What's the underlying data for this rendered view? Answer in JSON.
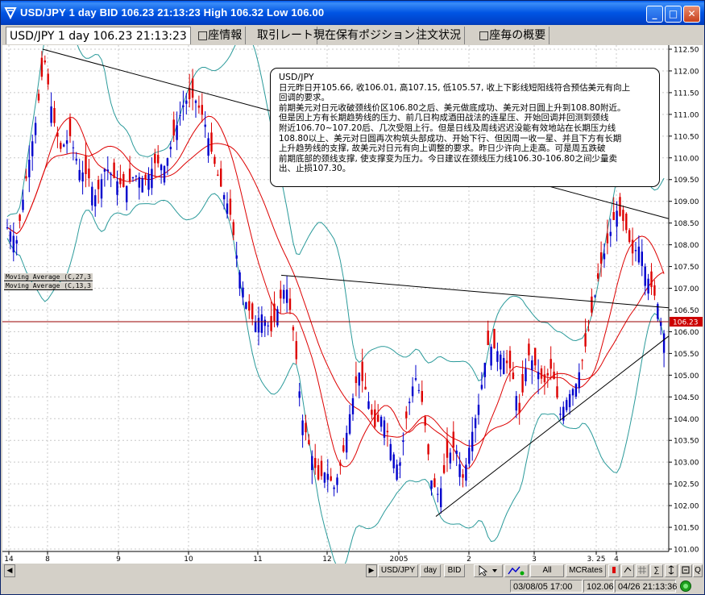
{
  "window": {
    "title": "USD/JPY 1 day BID 106.23 21:13:23 High 106.32 Low 106.00",
    "minimize_label": "_",
    "maximize_label": "□",
    "close_label": "✕"
  },
  "tabs": [
    {
      "label": "USD/JPY 1 day 106.23 21:13:23",
      "active": true
    },
    {
      "label": "□座情報",
      "active": false
    },
    {
      "label": "取引レート",
      "active": false
    },
    {
      "label": "現在保有ポジション",
      "active": false
    },
    {
      "label": "注文状況",
      "active": false
    },
    {
      "label": "□座毎の概要",
      "active": false
    }
  ],
  "annotation": {
    "title": "USD/JPY",
    "lines": [
      "日元昨日开105.66, 收106.01, 高107.15, 低105.57, 收上下影线短阳线符合预估美元有向上",
      "回调的要求。",
      "前期美元对日元收破颈线价区106.80之后、美元做底成功、美元对日圆上升到108.80附近。",
      "但是因上方有长期趋势线的压力、前几日构成酒田战法的连星压、开始回调并回测到颈线",
      "附近106.70~107.20后、几次受阻上行。但是日线及周线迟迟没能有效地站在长期压力线",
      "108.80以上、美元对日圆再次构筑头部成功、开始下行、但因周一收一星、并且下方有长期",
      "上升趋势线的支撑, 故美元对日元有向上调整的要求。昨日少许向上走高。可是周五跌破",
      "前期底部的颈线支撑, 使支撑变为压力。今日建议在颈线压力线106.30-106.80之间少量卖",
      "出、止损107.30。"
    ]
  },
  "indicators": [
    {
      "label": "Moving Average (C,27,3"
    },
    {
      "label": "Moving Average (C,13,3"
    }
  ],
  "toolbar": {
    "symbol": "USD/JPY",
    "period": "day",
    "side": "BID",
    "all_label": "All",
    "mcrates_label": "MCRates",
    "q_label": "Q"
  },
  "status": {
    "date1": "03/08/05 17:00",
    "value": "102.06",
    "date2": "04/26 21:13:36"
  },
  "chart_data": {
    "type": "candlestick",
    "title": "",
    "current_price": 106.23,
    "ylim": [
      101.0,
      112.6
    ],
    "y_ticks": [
      "112.50",
      "112.00",
      "111.50",
      "111.00",
      "110.50",
      "110.00",
      "109.50",
      "109.00",
      "108.50",
      "108.00",
      "107.50",
      "107.00",
      "106.50",
      "106.00",
      "105.50",
      "105.00",
      "104.50",
      "104.00",
      "103.50",
      "103.00",
      "102.50",
      "102.00",
      "101.50",
      "101.00"
    ],
    "x_ticks": [
      "14",
      "8",
      "9",
      "10",
      "11",
      "12",
      "2005",
      "2",
      "3",
      "3. 25",
      "4"
    ],
    "colors": {
      "up": "#0000cc",
      "down": "#dd0000",
      "ma": "#dd0000",
      "bands": "#2a9a9a",
      "trend": "#000000",
      "price_line": "#990000"
    },
    "key_prices": [
      112.5,
      110.0,
      109.0,
      106.8,
      101.5,
      108.8,
      106.23
    ],
    "trendlines": [
      {
        "from": {
          "x": "8",
          "price": 112.5
        },
        "to": {
          "x": "4+",
          "price": 108.6
        }
      },
      {
        "from": {
          "x": "11",
          "price": 107.3
        },
        "to": {
          "x": "4+",
          "price": 106.55
        }
      },
      {
        "from": {
          "x": "2005",
          "price": 101.75
        },
        "to": {
          "x": "4+",
          "price": 105.9
        }
      }
    ]
  }
}
